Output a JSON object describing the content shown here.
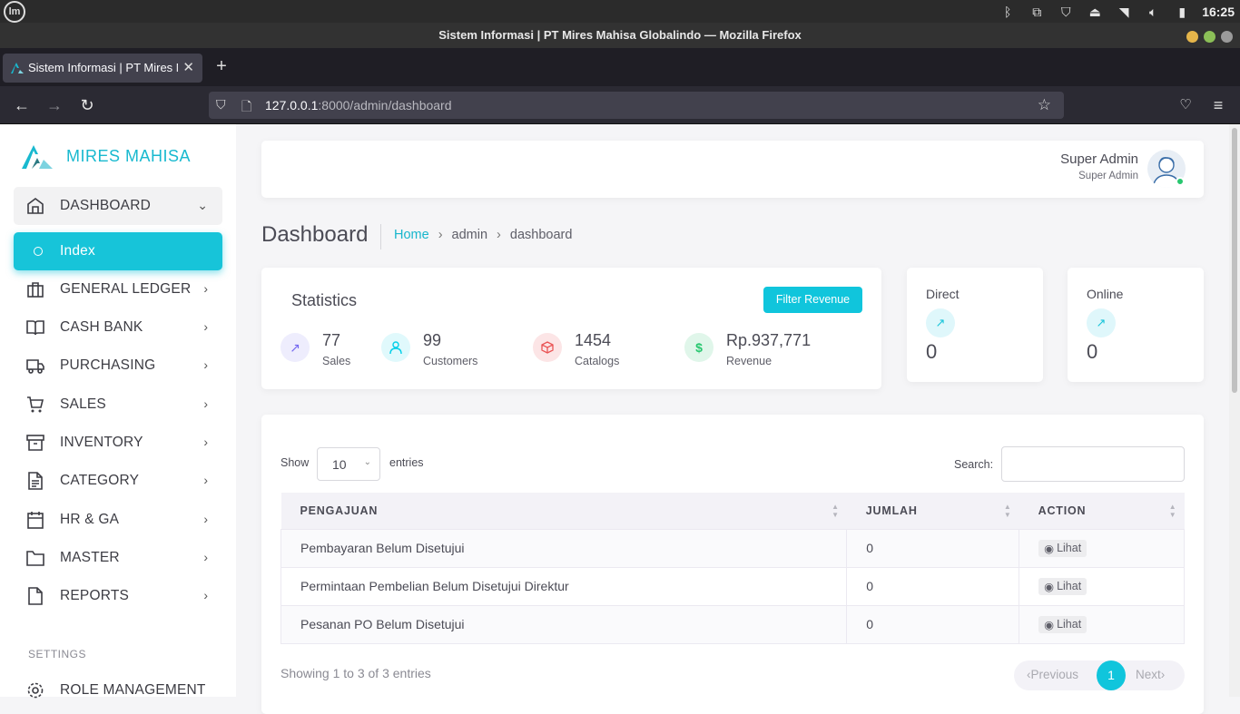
{
  "os": {
    "clock": "16:25",
    "logo": "lm",
    "tray_icons": [
      "bluetooth-icon",
      "update-icon",
      "shield-icon",
      "eject-icon",
      "wifi-icon",
      "volume-icon",
      "battery-icon"
    ]
  },
  "browser": {
    "window_title": "Sistem Informasi | PT Mires Mahisa Globalindo — Mozilla Firefox",
    "tab_title": "Sistem Informasi | PT Mires Mahisa Globalindo",
    "url_host": "127.0.0.1",
    "url_path": ":8000/admin/dashboard",
    "new_tab": "+",
    "close_tab": "✕"
  },
  "sidebar": {
    "brand": "MIRES MAHISA",
    "items": [
      {
        "label": "DASHBOARD",
        "icon": "home-icon"
      },
      {
        "label": "Index",
        "icon": "circle-icon"
      },
      {
        "label": "GENERAL LEDGER",
        "icon": "briefcase-icon"
      },
      {
        "label": "CASH BANK",
        "icon": "book-icon"
      },
      {
        "label": "PURCHASING",
        "icon": "truck-icon"
      },
      {
        "label": "SALES",
        "icon": "cart-icon"
      },
      {
        "label": "INVENTORY",
        "icon": "archive-icon"
      },
      {
        "label": "CATEGORY",
        "icon": "file-text-icon"
      },
      {
        "label": "HR & GA",
        "icon": "calendar-icon"
      },
      {
        "label": "MASTER",
        "icon": "folder-icon"
      },
      {
        "label": "REPORTS",
        "icon": "file-icon"
      }
    ],
    "settings_heading": "SETTINGS",
    "settings_items": [
      {
        "label": "ROLE MANAGEMENT",
        "icon": "settings-icon"
      }
    ]
  },
  "header": {
    "user_name": "Super Admin",
    "user_role": "Super Admin"
  },
  "page": {
    "title": "Dashboard",
    "breadcrumb": [
      "Home",
      "admin",
      "dashboard"
    ],
    "breadcrumb_sep": "›"
  },
  "statistics": {
    "title": "Statistics",
    "filter_button": "Filter Revenue",
    "items": [
      {
        "value": "77",
        "label": "Sales",
        "color": "#7367f0"
      },
      {
        "value": "99",
        "label": "Customers",
        "color": "#00cfe8"
      },
      {
        "value": "1454",
        "label": "Catalogs",
        "color": "#ea5455"
      },
      {
        "value": "Rp.937,771",
        "label": "Revenue",
        "color": "#28c76f"
      }
    ]
  },
  "mini_cards": [
    {
      "title": "Direct",
      "value": "0"
    },
    {
      "title": "Online",
      "value": "0"
    }
  ],
  "table": {
    "show_label": "Show",
    "page_size": "10",
    "entries_label": "entries",
    "search_label": "Search:",
    "columns": [
      "PENGAJUAN",
      "JUMLAH",
      "ACTION"
    ],
    "rows": [
      {
        "pengajuan": "Pembayaran Belum Disetujui",
        "jumlah": "0",
        "action": "Lihat"
      },
      {
        "pengajuan": "Permintaan Pembelian Belum Disetujui Direktur",
        "jumlah": "0",
        "action": "Lihat"
      },
      {
        "pengajuan": "Pesanan PO Belum Disetujui",
        "jumlah": "0",
        "action": "Lihat"
      }
    ],
    "info": "Showing 1 to 3 of 3 entries",
    "prev": "Previous",
    "page": "1",
    "next": "Next"
  },
  "colors": {
    "accent": "#10c5dc",
    "text": "#4b4b55",
    "online": "#28c76f"
  }
}
